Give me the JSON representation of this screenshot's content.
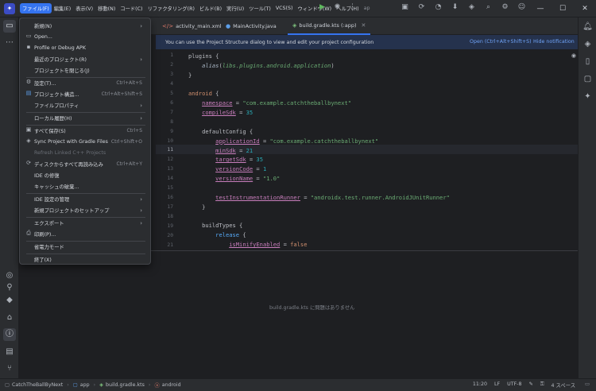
{
  "menubar": {
    "items": [
      "ファイル(F)",
      "編集(E)",
      "表示(V)",
      "移動(N)",
      "コード(C)",
      "リファクタリング(R)",
      "ビルド(B)",
      "実行(U)",
      "ツール(T)",
      "VCS(S)",
      "ウィンドウ(W)",
      "ヘルプ(H)"
    ],
    "extra": "ap"
  },
  "window_controls": {
    "minimize": "—",
    "maximize": "☐",
    "close": "✕"
  },
  "tabs": [
    {
      "label": "activity_main.xml"
    },
    {
      "label": "MainActivity.java"
    },
    {
      "label": "build.gradle.kts (:app)"
    }
  ],
  "banner": {
    "message": "You can use the Project Structure dialog to view and edit your project configuration",
    "open_link": "Open (Ctrl+Alt+Shift+S)",
    "hide_link": "Hide notification"
  },
  "editor": {
    "line_numbers": [
      "1",
      "2",
      "3",
      "4",
      "5",
      "6",
      "7",
      "8",
      "9",
      "10",
      "11",
      "12",
      "13",
      "14",
      "15",
      "16",
      "17",
      "18",
      "19",
      "20",
      "21"
    ],
    "current_line": "11"
  },
  "file_menu": {
    "items": [
      {
        "label": "新規(N)",
        "arrow": "›"
      },
      {
        "label": "Open...",
        "icon": "folder-icon"
      },
      {
        "label": "Profile or Debug APK"
      },
      {
        "label": "最近のプロジェクト(R)",
        "arrow": "›"
      },
      {
        "label": "プロジェクトを閉じる(J)"
      },
      {
        "label": "設定(T)...",
        "shortcut": "Ctrl+Alt+S",
        "icon": "gear-icon"
      },
      {
        "label": "プロジェクト構造...",
        "shortcut": "Ctrl+Alt+Shift+S",
        "icon": "project-structure-icon"
      },
      {
        "label": "ファイルプロパティ",
        "arrow": "›"
      },
      {
        "label": "ローカル履歴(H)",
        "arrow": "›"
      },
      {
        "label": "すべて保存(S)",
        "shortcut": "Ctrl+S",
        "icon": "save-icon"
      },
      {
        "label": "Sync Project with Gradle Files",
        "shortcut": "Ctrl+Shift+O",
        "icon": "gradle-sync-icon"
      },
      {
        "label": "Refresh Linked C++ Projects"
      },
      {
        "label": "ディスクからすべて再読み込み",
        "shortcut": "Ctrl+Alt+Y",
        "icon": "reload-icon"
      },
      {
        "label": "IDE の修復"
      },
      {
        "label": "キャッシュの破棄..."
      },
      {
        "label": "IDE 設定の管理",
        "arrow": "›"
      },
      {
        "label": "新規プロジェクトのセットアップ",
        "arrow": "›"
      },
      {
        "label": "エクスポート",
        "arrow": "›"
      },
      {
        "label": "印刷(P)...",
        "icon": "print-icon"
      },
      {
        "label": "省電力モード"
      },
      {
        "label": "終了(X)"
      }
    ]
  },
  "lower_panel": {
    "message": "build.gradle.kts に問題はありません"
  },
  "statusbar": {
    "breadcrumb": [
      "CatchTheBallByNext",
      "app",
      "build.gradle.kts",
      "android"
    ],
    "position": "11:20",
    "line_ending": "LF",
    "encoding": "UTF-8",
    "indent": "4 スペース"
  }
}
